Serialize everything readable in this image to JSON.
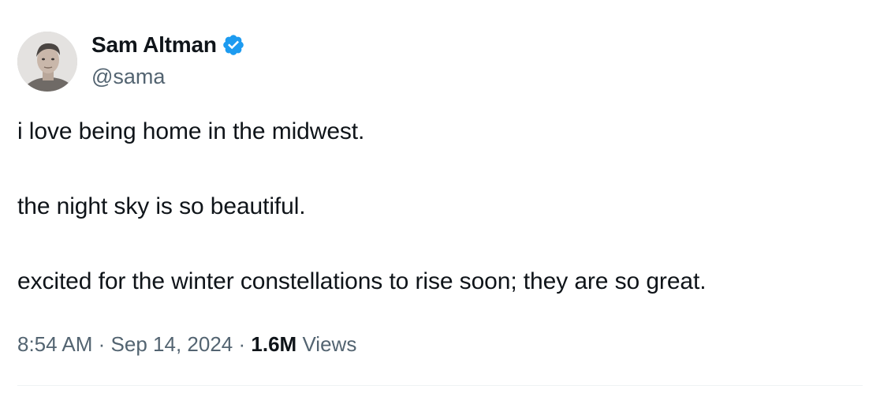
{
  "author": {
    "display_name": "Sam Altman",
    "handle": "@sama",
    "verified": true,
    "verified_color": "#1d9bf0"
  },
  "tweet": {
    "paragraphs": [
      "i love being home in the midwest.",
      "the night sky is so beautiful.",
      "excited for the winter constellations to rise soon; they are so great."
    ]
  },
  "meta": {
    "time": "8:54 AM",
    "separator": "·",
    "date": "Sep 14, 2024",
    "views_count": "1.6M",
    "views_label": "Views"
  },
  "colors": {
    "text": "#0f1419",
    "secondary": "#536471",
    "divider": "#eff3f4"
  },
  "icons": {
    "avatar": "user-avatar",
    "verified": "verified-badge-icon"
  }
}
